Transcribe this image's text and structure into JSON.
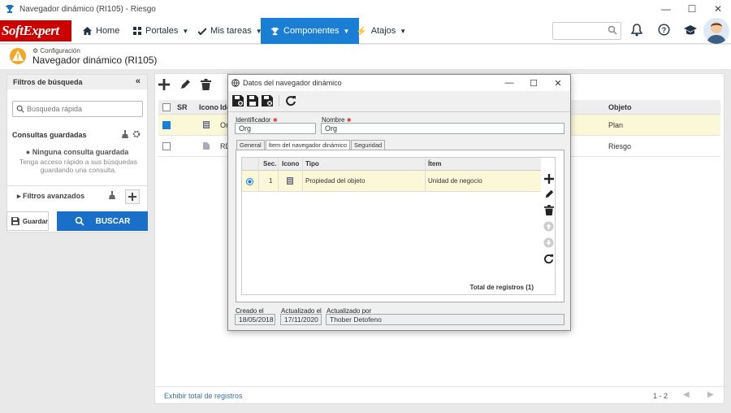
{
  "window": {
    "title": "Navegador dinámico (RI105) - Riesgo"
  },
  "nav": {
    "logo": "SoftExpert",
    "home": "Home",
    "portales": "Portales",
    "tareas": "Mis tareas",
    "componentes": "Componentes",
    "atajos": "Atajos"
  },
  "header": {
    "breadcrumb": "Configuración",
    "title": "Navegador dinámico (RI105)"
  },
  "filters": {
    "title": "Filtros de búsqueda",
    "quick_search_placeholder": "Búsqueda rápida",
    "saved_title": "Consultas guardadas",
    "no_query": "Ninguna consulta guardada",
    "no_query_hint": "Tenga acceso rápido a sus búsquedas guardando una consulta.",
    "advanced": "Filtros avanzados",
    "save": "Guardar",
    "search": "BUSCAR"
  },
  "grid": {
    "columns": {
      "sr": "SR",
      "icon": "Icono",
      "id": "Ide",
      "object": "Objeto"
    },
    "rows": [
      {
        "id": "Or",
        "object": "Plan",
        "checked": true
      },
      {
        "id": "RD",
        "object": "Riesgo",
        "checked": false
      }
    ],
    "show_total": "Exhibir total de registros",
    "paging": "1 - 2"
  },
  "dialog": {
    "title": "Datos del navegador dinámico",
    "id_label": "Identificador",
    "id_value": "Org",
    "name_label": "Nombre",
    "name_value": "Org",
    "tabs": [
      "General",
      "Ítem del navegador dinámico",
      "Seguridad"
    ],
    "items": {
      "columns": {
        "seq": "Sec.",
        "icon": "Icono",
        "type": "Tipo",
        "item": "Ítem"
      },
      "row": {
        "seq": "1",
        "type": "Propiedad del objeto",
        "item": "Unidad de negocio"
      },
      "total": "Total de registros (1)"
    },
    "created_label": "Creado el",
    "created_value": "18/05/2018",
    "updated_label": "Actualizado el",
    "updated_value": "17/11/2020",
    "updated_by_label": "Actualizado por",
    "updated_by_value": "Thober Detofeno"
  },
  "colors": {
    "accent": "#1a7fd4",
    "brand": "#cc0000",
    "selected_row": "#fbf8d8"
  }
}
